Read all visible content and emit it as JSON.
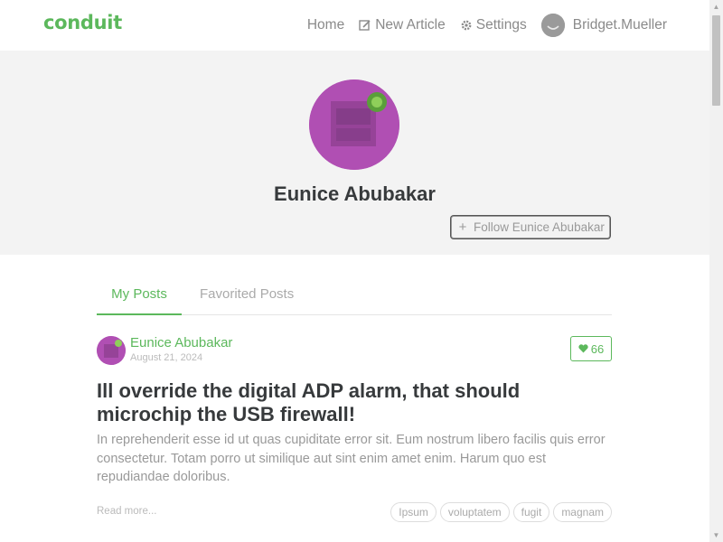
{
  "navbar": {
    "brand": "conduit",
    "links": {
      "home": "Home",
      "new_article": "New Article",
      "settings": "Settings",
      "username": "Bridget.Mueller"
    }
  },
  "profile": {
    "name": "Eunice Abubakar",
    "follow_label": "Follow Eunice Abubakar"
  },
  "tabs": {
    "my_posts": "My Posts",
    "favorited_posts": "Favorited Posts"
  },
  "article": {
    "author": "Eunice Abubakar",
    "date": "August 21, 2024",
    "favorites_count": "66",
    "title": "Ill override the digital ADP alarm, that should microchip the USB firewall!",
    "description": "In reprehenderit esse id ut quas cupiditate error sit. Eum nostrum libero facilis quis error consectetur. Totam porro ut similique aut sint enim amet enim. Harum quo est repudiandae doloribus.",
    "read_more": "Read more...",
    "tags": [
      "Ipsum",
      "voluptatem",
      "fugit",
      "magnam"
    ]
  },
  "colors": {
    "accent": "#5cb85c",
    "banner_bg": "#f3f3f3",
    "avatar_bg": "#b04fb3"
  },
  "icons": [
    "edit-icon",
    "gear-icon",
    "avatar-icon",
    "plus-icon",
    "heart-icon"
  ]
}
